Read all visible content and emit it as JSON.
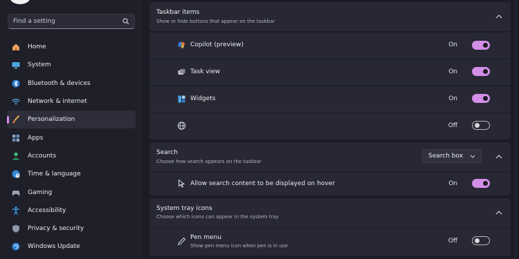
{
  "sidebar": {
    "search_placeholder": "Find a setting",
    "items": [
      {
        "label": "Home",
        "icon": "home-icon"
      },
      {
        "label": "System",
        "icon": "monitor-icon"
      },
      {
        "label": "Bluetooth & devices",
        "icon": "bluetooth-icon"
      },
      {
        "label": "Network & internet",
        "icon": "wifi-icon"
      },
      {
        "label": "Personalization",
        "icon": "brush-icon",
        "active": true
      },
      {
        "label": "Apps",
        "icon": "apps-icon"
      },
      {
        "label": "Accounts",
        "icon": "person-icon"
      },
      {
        "label": "Time & language",
        "icon": "globe-clock-icon"
      },
      {
        "label": "Gaming",
        "icon": "gamepad-icon"
      },
      {
        "label": "Accessibility",
        "icon": "accessibility-icon"
      },
      {
        "label": "Privacy & security",
        "icon": "shield-icon"
      },
      {
        "label": "Windows Update",
        "icon": "update-icon"
      }
    ]
  },
  "taskbar_items": {
    "title": "Taskbar items",
    "subtitle": "Show or hide buttons that appear on the taskbar",
    "rows": [
      {
        "label": "Copilot (preview)",
        "state": "On",
        "on": true,
        "icon": "copilot-icon"
      },
      {
        "label": "Task view",
        "state": "On",
        "on": true,
        "icon": "task-view-icon"
      },
      {
        "label": "Widgets",
        "state": "On",
        "on": true,
        "icon": "widgets-icon"
      },
      {
        "label": "",
        "state": "Off",
        "on": false,
        "icon": "globe-icon"
      }
    ]
  },
  "search_section": {
    "title": "Search",
    "subtitle": "Choose how search appears on the taskbar",
    "dropdown_value": "Search box",
    "hover_row": {
      "label": "Allow search content to be displayed on hover",
      "state": "On",
      "on": true,
      "icon": "cursor-icon"
    }
  },
  "tray_icons": {
    "title": "System tray icons",
    "subtitle": "Choose which icons can appear in the system tray",
    "pen_row": {
      "label": "Pen menu",
      "sub": "Show pen menu icon when pen is in use",
      "state": "Off",
      "on": false,
      "icon": "pen-icon"
    }
  },
  "colors": {
    "accent": "#d38ee8",
    "card": "#272834",
    "background": "#1c1c26"
  }
}
